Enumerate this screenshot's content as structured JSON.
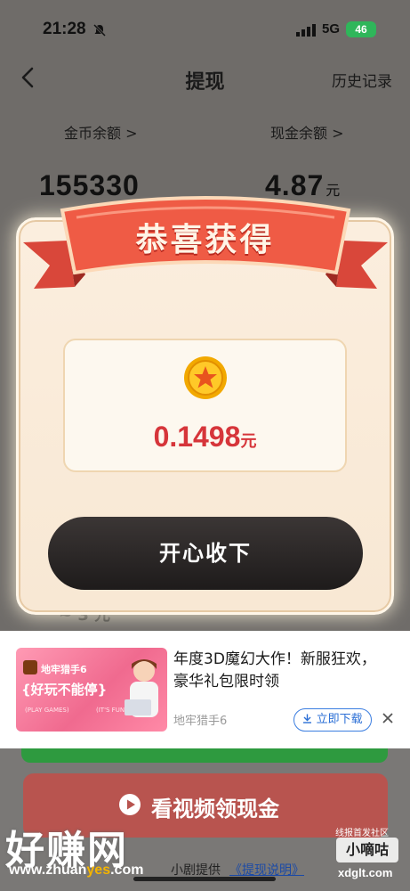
{
  "status_bar": {
    "time": "21:28",
    "network": "5G",
    "battery": "46"
  },
  "header": {
    "title": "提现",
    "history": "历史记录"
  },
  "balances": {
    "coin_label": "金币余额 >",
    "coin_value": "155330",
    "cash_label": "现金余额 >",
    "cash_value": "4.87",
    "cash_unit": "元"
  },
  "dialog": {
    "title": "恭喜获得",
    "amount": "0.1498",
    "unit": "元",
    "accept_button": "开心收下",
    "partial_text_behind": "~ 3 元"
  },
  "ad": {
    "title": "年度3D魔幻大作！新服狂欢，豪华礼包限时领",
    "source": "地牢猎手6",
    "download_button": "立即下载",
    "image": {
      "game_name": "地牢猎手6",
      "slogan": "{好玩不能停}",
      "tag_left": "(PLAY GAMES)",
      "tag_right": "(IT'S FUN)"
    }
  },
  "bottom": {
    "video_button": "看视频领现金",
    "provider": "小剧提供",
    "explain_link": "《提现说明》"
  },
  "watermarks": {
    "big": "好赚网",
    "url_prefix": "www.zhuan",
    "url_highlight": "yes",
    "url_suffix": ".com",
    "small_top": "线报首发社区",
    "small_name": "小嘀咕",
    "small_url": "xdglt.com"
  },
  "colors": {
    "accent_red": "#d6353a",
    "ribbon": "#ef5b45",
    "dialog_bg": "#fbeede",
    "button_dark": "#2b2626",
    "link_blue": "#2b6fd6"
  }
}
